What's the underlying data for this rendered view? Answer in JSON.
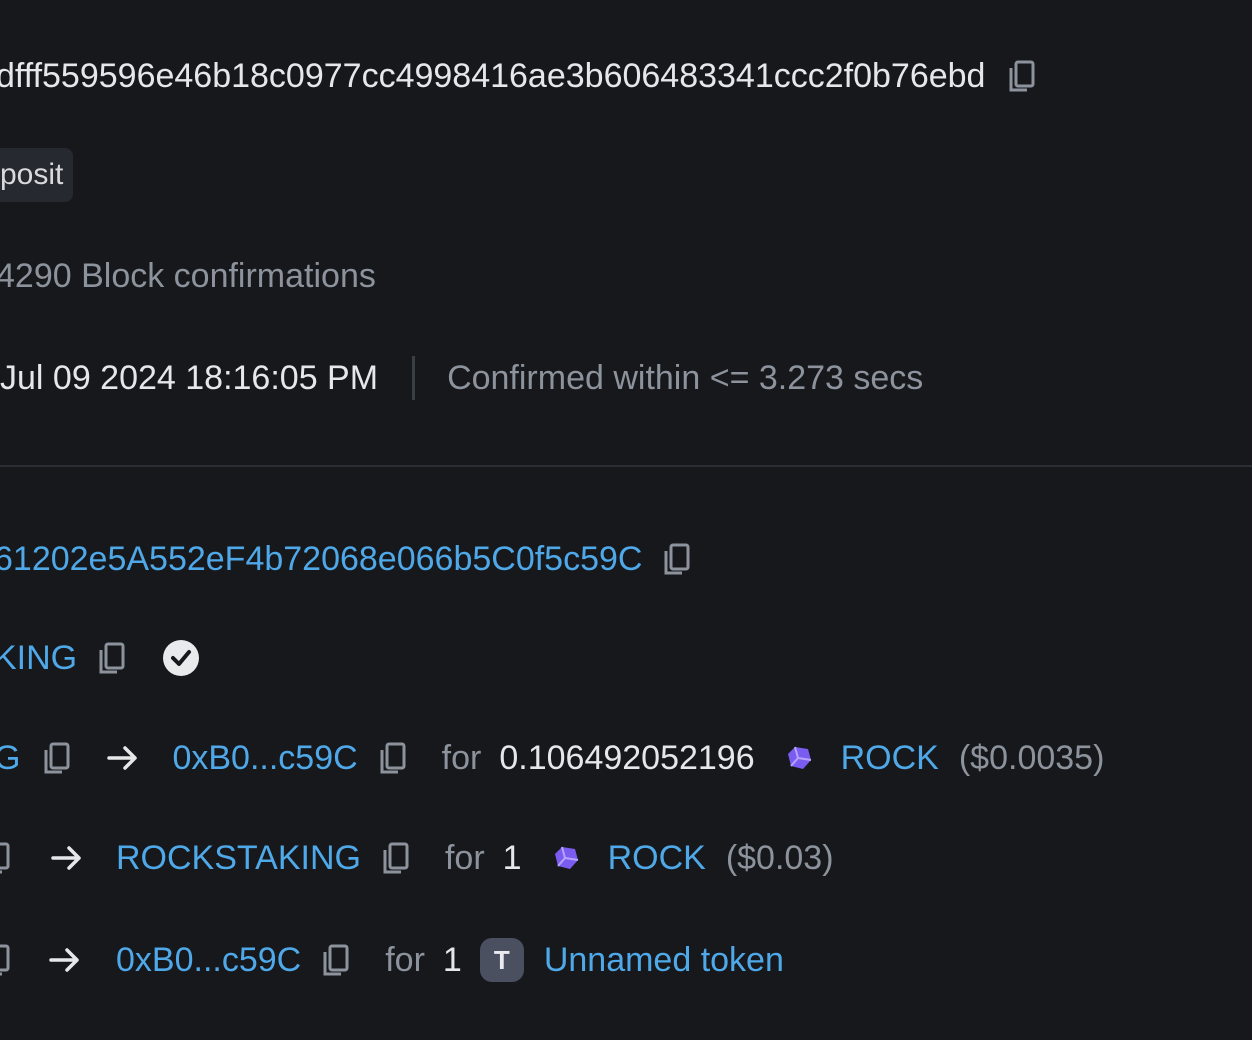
{
  "tx_hash": "dfff559596e46b18c0977cc4998416ae3b606483341ccc2f0b76ebd",
  "method_tag": "posit",
  "confirmations": "4290 Block confirmations",
  "timestamp": {
    "datetime": "Jul 09 2024 18:16:05 PM",
    "confirmed_within": "Confirmed within <= 3.273 secs"
  },
  "to_address": "61202e5A552eF4b72068e066b5C0f5c59C",
  "contract_name": "KING",
  "transfers": [
    {
      "from_fragment": "G",
      "to": "0xB0...c59C",
      "for_label": "for",
      "amount": "0.106492052196",
      "token": "ROCK",
      "usd": "($0.0035)"
    },
    {
      "to": "ROCKSTAKING",
      "for_label": "for",
      "amount": "1",
      "token": "ROCK",
      "usd": "($0.03)"
    },
    {
      "to": "0xB0...c59C",
      "for_label": "for",
      "amount": "1",
      "token_badge": "T",
      "token": "Unnamed token"
    }
  ],
  "icons": {
    "copy": "copy-icon",
    "arrow": "arrow-right-icon",
    "token": "rock-token-icon",
    "verified": "verified-check-icon"
  },
  "colors": {
    "background": "#16181c",
    "link": "#4fa8e8",
    "muted": "#8d939c",
    "tag_bg": "#262a30",
    "rock_purple": "#7b5cf0"
  }
}
